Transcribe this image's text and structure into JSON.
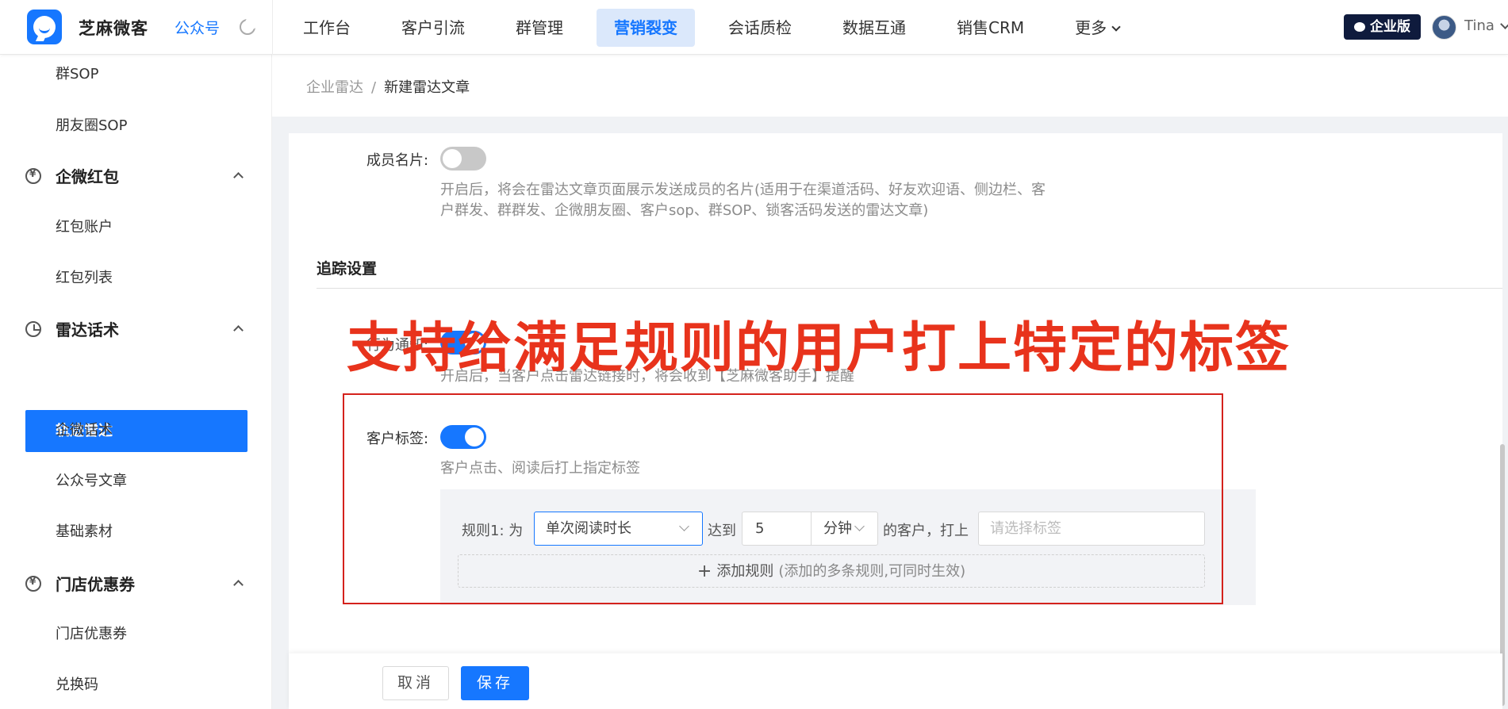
{
  "app": {
    "brand": "芝麻微客",
    "account_link": "公众号",
    "theme_icon": "moon-icon"
  },
  "nav": {
    "items": [
      {
        "label": "工作台",
        "active": false
      },
      {
        "label": "客户引流",
        "active": false
      },
      {
        "label": "群管理",
        "active": false
      },
      {
        "label": "营销裂变",
        "active": true
      },
      {
        "label": "会话质检",
        "active": false
      },
      {
        "label": "数据互通",
        "active": false
      },
      {
        "label": "销售CRM",
        "active": false
      },
      {
        "label": "更多",
        "active": false,
        "dropdown": true
      }
    ],
    "edition_badge": "企业版",
    "user_name": "Tina"
  },
  "sidebar": {
    "items": [
      {
        "label": "群SOP",
        "type": "sub"
      },
      {
        "label": "朋友圈SOP",
        "type": "sub"
      },
      {
        "label": "企微红包",
        "type": "group",
        "icon": "redpacket-icon",
        "expanded": true
      },
      {
        "label": "红包账户",
        "type": "sub"
      },
      {
        "label": "红包列表",
        "type": "sub"
      },
      {
        "label": "雷达话术",
        "type": "group",
        "icon": "radar-icon",
        "expanded": true
      },
      {
        "label": "轨迹雷达",
        "type": "sub",
        "active": true
      },
      {
        "label": "企微话术",
        "type": "sub"
      },
      {
        "label": "公众号文章",
        "type": "sub"
      },
      {
        "label": "基础素材",
        "type": "sub"
      },
      {
        "label": "门店优惠券",
        "type": "group",
        "icon": "redpacket-icon",
        "expanded": true
      },
      {
        "label": "门店优惠券",
        "type": "sub"
      },
      {
        "label": "兑换码",
        "type": "sub"
      }
    ]
  },
  "breadcrumb": {
    "parent": "企业雷达",
    "separator": "/",
    "current": "新建雷达文章"
  },
  "form": {
    "member_card": {
      "label": "成员名片:",
      "enabled": false,
      "desc_line1": "开启后，将会在雷达文章页面展示发送成员的名片(适用于在渠道活码、好友欢迎语、侧边栏、客",
      "desc_line2": "户群发、群群发、企微朋友圈、客户sop、群SOP、锁客活码发送的雷达文章)"
    },
    "tracking_section_title": "追踪设置",
    "behavior_notice": {
      "label_partial": "行为通知:",
      "enabled": true,
      "desc": "开启后，当客户点击雷达链接时，将会收到【芝麻微客助手】提醒"
    },
    "customer_tag": {
      "label": "客户标签:",
      "enabled": true,
      "desc": "客户点击、阅读后打上指定标签"
    },
    "rule": {
      "prefix": "规则1:",
      "for": "为",
      "condition": "单次阅读时长",
      "reach": "达到",
      "value": "5",
      "unit": "分钟",
      "suffix": "的客户，打上",
      "tag_placeholder": "请选择标签"
    },
    "add_rule": {
      "label": "添加规则",
      "hint": "(添加的多条规则,可同时生效)"
    }
  },
  "overlay_text": "支持给满足规则的用户打上特定的标签",
  "footer": {
    "cancel": "取消",
    "save": "保存"
  },
  "colors": {
    "primary": "#1677ff",
    "overlay_red": "#e8331c",
    "highlight_border": "#d4221c"
  }
}
